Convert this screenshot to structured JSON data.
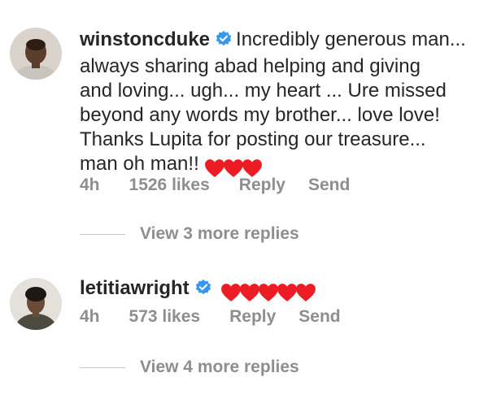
{
  "comments": [
    {
      "username": "winstoncduke",
      "verified": true,
      "text_lines": [
        "Incredibly generous man...",
        "always sharing abad helping and giving",
        "and loving... ugh... my heart ... Ure missed",
        "beyond any words my brother... love love!",
        "Thanks Lupita for posting our treasure...",
        "man oh man!!"
      ],
      "heart_count": 3,
      "time": "4h",
      "likes": "1526 likes",
      "reply_label": "Reply",
      "send_label": "Send",
      "view_replies": "View 3 more replies"
    },
    {
      "username": "letitiawright",
      "verified": true,
      "heart_count": 5,
      "time": "4h",
      "likes": "573 likes",
      "reply_label": "Reply",
      "send_label": "Send",
      "view_replies": "View 4 more replies"
    }
  ],
  "colors": {
    "verified_badge": "#3897f0",
    "heart": "#ed1c24",
    "secondary_text": "#8e8e8e",
    "primary_text": "#262626"
  }
}
